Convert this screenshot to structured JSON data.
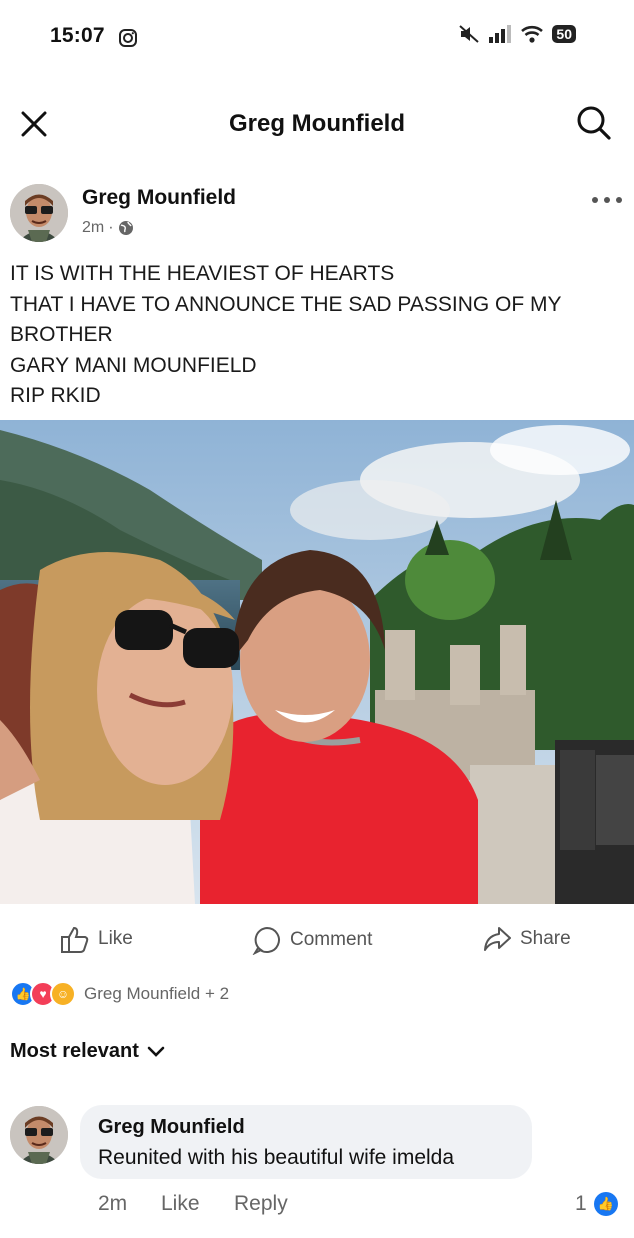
{
  "status_bar": {
    "time": "15:07",
    "battery": "50"
  },
  "header": {
    "title": "Greg Mounfield"
  },
  "post": {
    "author": "Greg Mounfield",
    "time": "2m",
    "text_lines": [
      "IT IS WITH THE HEAVIEST OF HEARTS",
      "THAT I HAVE TO ANNOUNCE THE SAD PASSING OF MY",
      "BROTHER",
      "GARY MANI MOUNFIELD",
      "RIP RKID"
    ]
  },
  "actions": {
    "like": "Like",
    "comment": "Comment",
    "share": "Share"
  },
  "reactions": {
    "text": "Greg Mounfield + 2"
  },
  "sort": {
    "label": "Most relevant"
  },
  "comment": {
    "author": "Greg Mounfield",
    "text": "Reunited with his beautiful wife imelda",
    "time": "2m",
    "like": "Like",
    "reply": "Reply",
    "reaction_count": "1"
  },
  "colors": {
    "facebook_blue": "#1877f2",
    "love_red": "#f33e58",
    "shirt_red": "#e8232f"
  }
}
